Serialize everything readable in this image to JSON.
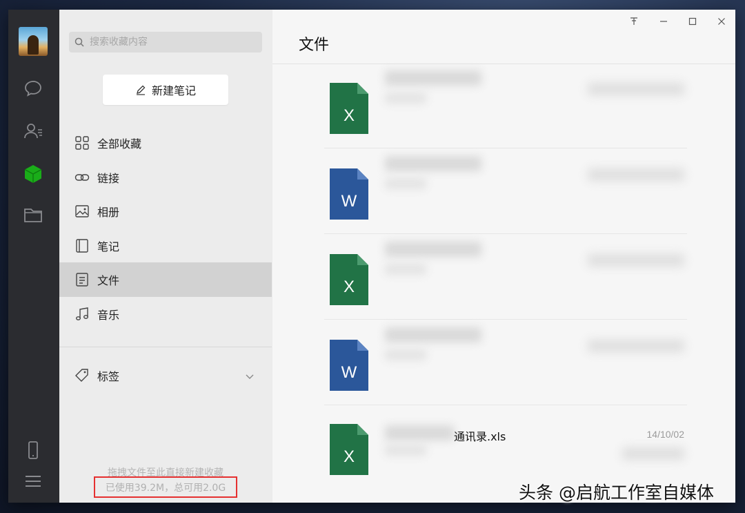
{
  "sidebar": {
    "search_placeholder": "搜索收藏内容",
    "new_note_label": "新建笔记",
    "items": [
      {
        "label": "全部收藏",
        "icon": "grid-icon"
      },
      {
        "label": "链接",
        "icon": "link-icon"
      },
      {
        "label": "相册",
        "icon": "image-icon"
      },
      {
        "label": "笔记",
        "icon": "notebook-icon"
      },
      {
        "label": "文件",
        "icon": "document-icon",
        "active": true
      },
      {
        "label": "音乐",
        "icon": "music-note-icon"
      }
    ],
    "tags_label": "标签",
    "drop_hint": "拖拽文件至此直接新建收藏",
    "storage_usage": "已使用39.2M，总可用2.0G"
  },
  "rail": {
    "icons": [
      "avatar",
      "chat-icon",
      "contacts-icon",
      "favorites-cube-icon",
      "folder-icon",
      "phone-icon",
      "menu-icon"
    ],
    "accent": "#1aad19"
  },
  "main": {
    "title": "文件",
    "files": [
      {
        "type": "excel",
        "badge": "X",
        "name": "",
        "date": ""
      },
      {
        "type": "word",
        "badge": "W",
        "name": "",
        "date": ""
      },
      {
        "type": "excel",
        "badge": "X",
        "name": "",
        "date": ""
      },
      {
        "type": "word",
        "badge": "W",
        "name": "",
        "date": ""
      },
      {
        "type": "excel",
        "badge": "X",
        "name": "通讯录.xls",
        "date": "14/10/02"
      }
    ],
    "colors": {
      "excel": "#217346",
      "word": "#2b579a"
    }
  },
  "watermark": "头条 @启航工作室自媒体"
}
